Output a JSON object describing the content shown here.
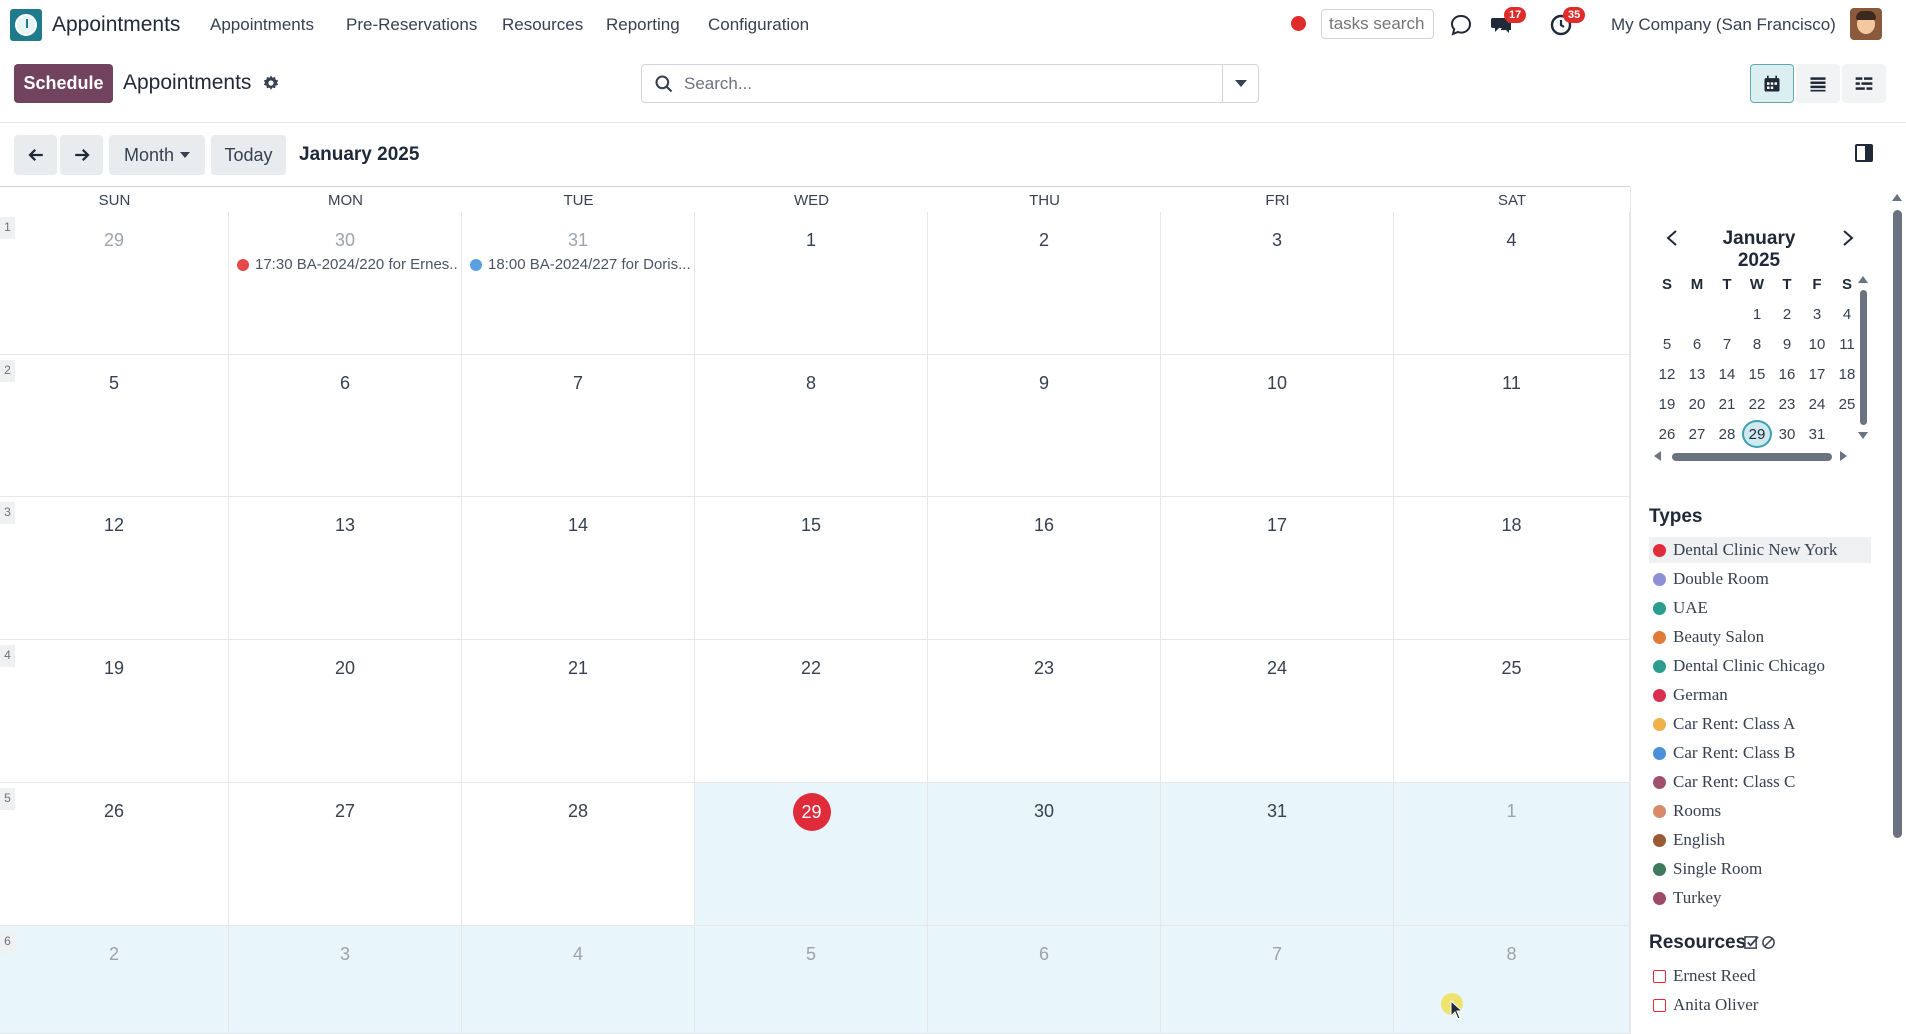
{
  "app": {
    "name": "Appointments"
  },
  "menu": [
    "Appointments",
    "Pre-Reservations",
    "Resources",
    "Reporting",
    "Configuration"
  ],
  "systray": {
    "tasks_search_placeholder": "tasks search",
    "messages_badge": "17",
    "activities_badge": "35",
    "company": "My Company (San Francisco)"
  },
  "control": {
    "schedule_label": "Schedule",
    "title": "Appointments",
    "search_placeholder": "Search..."
  },
  "toolbar": {
    "scale_label": "Month",
    "today_label": "Today",
    "period": "January 2025"
  },
  "weekdays": [
    "SUN",
    "MON",
    "TUE",
    "WED",
    "THU",
    "FRI",
    "SAT"
  ],
  "weeks": [
    {
      "week": "1",
      "days": [
        {
          "n": "29",
          "muted": true
        },
        {
          "n": "30",
          "muted": true
        },
        {
          "n": "31",
          "muted": true
        },
        {
          "n": "1"
        },
        {
          "n": "2"
        },
        {
          "n": "3"
        },
        {
          "n": "4"
        }
      ]
    },
    {
      "week": "2",
      "days": [
        {
          "n": "5"
        },
        {
          "n": "6"
        },
        {
          "n": "7"
        },
        {
          "n": "8"
        },
        {
          "n": "9"
        },
        {
          "n": "10"
        },
        {
          "n": "11"
        }
      ]
    },
    {
      "week": "3",
      "days": [
        {
          "n": "12"
        },
        {
          "n": "13"
        },
        {
          "n": "14"
        },
        {
          "n": "15"
        },
        {
          "n": "16"
        },
        {
          "n": "17"
        },
        {
          "n": "18"
        }
      ]
    },
    {
      "week": "4",
      "days": [
        {
          "n": "19"
        },
        {
          "n": "20"
        },
        {
          "n": "21"
        },
        {
          "n": "22"
        },
        {
          "n": "23"
        },
        {
          "n": "24"
        },
        {
          "n": "25"
        }
      ]
    },
    {
      "week": "5",
      "days": [
        {
          "n": "26"
        },
        {
          "n": "27"
        },
        {
          "n": "28"
        },
        {
          "n": "29",
          "today": true,
          "shaded": true
        },
        {
          "n": "30",
          "shaded": true
        },
        {
          "n": "31",
          "shaded": true
        },
        {
          "n": "1",
          "muted": true,
          "shaded": true
        }
      ]
    },
    {
      "week": "6",
      "days": [
        {
          "n": "2",
          "muted": true,
          "shaded": true
        },
        {
          "n": "3",
          "muted": true,
          "shaded": true
        },
        {
          "n": "4",
          "muted": true,
          "shaded": true
        },
        {
          "n": "5",
          "muted": true,
          "shaded": true
        },
        {
          "n": "6",
          "muted": true,
          "shaded": true
        },
        {
          "n": "7",
          "muted": true,
          "shaded": true
        },
        {
          "n": "8",
          "muted": true,
          "shaded": true
        }
      ]
    }
  ],
  "events": [
    {
      "week": 0,
      "day": 1,
      "text": "17:30 BA-2024/220 for Ernes...",
      "color": "#e5484d"
    },
    {
      "week": 0,
      "day": 2,
      "text": "18:00 BA-2024/227 for Doris...",
      "color": "#5aa0e0"
    }
  ],
  "mini_calendar": {
    "title": "January 2025",
    "headers": [
      "S",
      "M",
      "T",
      "W",
      "T",
      "F",
      "S"
    ],
    "rows": [
      [
        "",
        "",
        "",
        "1",
        "2",
        "3",
        "4"
      ],
      [
        "5",
        "6",
        "7",
        "8",
        "9",
        "10",
        "11"
      ],
      [
        "12",
        "13",
        "14",
        "15",
        "16",
        "17",
        "18"
      ],
      [
        "19",
        "20",
        "21",
        "22",
        "23",
        "24",
        "25"
      ],
      [
        "26",
        "27",
        "28",
        "29",
        "30",
        "31",
        ""
      ]
    ],
    "today": "29"
  },
  "types": {
    "title": "Types",
    "items": [
      {
        "label": "Dental Clinic New York",
        "color": "#e02b3a",
        "highlighted": true
      },
      {
        "label": "Double Room",
        "color": "#8f8fd8"
      },
      {
        "label": "UAE",
        "color": "#2a9d8f"
      },
      {
        "label": "Beauty Salon",
        "color": "#e07b39"
      },
      {
        "label": "Dental Clinic Chicago",
        "color": "#2a9d8f"
      },
      {
        "label": "German",
        "color": "#d9304f"
      },
      {
        "label": "Car Rent: Class A",
        "color": "#f0b04a"
      },
      {
        "label": "Car Rent: Class B",
        "color": "#4a90d9"
      },
      {
        "label": "Car Rent: Class C",
        "color": "#a0506e"
      },
      {
        "label": "Rooms",
        "color": "#d98a6a"
      },
      {
        "label": "English",
        "color": "#9a5a34"
      },
      {
        "label": "Single Room",
        "color": "#3d7a5e"
      },
      {
        "label": "Turkey",
        "color": "#a04a6a"
      }
    ]
  },
  "resources": {
    "title": "Resources",
    "items": [
      {
        "label": "Ernest Reed"
      },
      {
        "label": "Anita Oliver"
      }
    ]
  }
}
